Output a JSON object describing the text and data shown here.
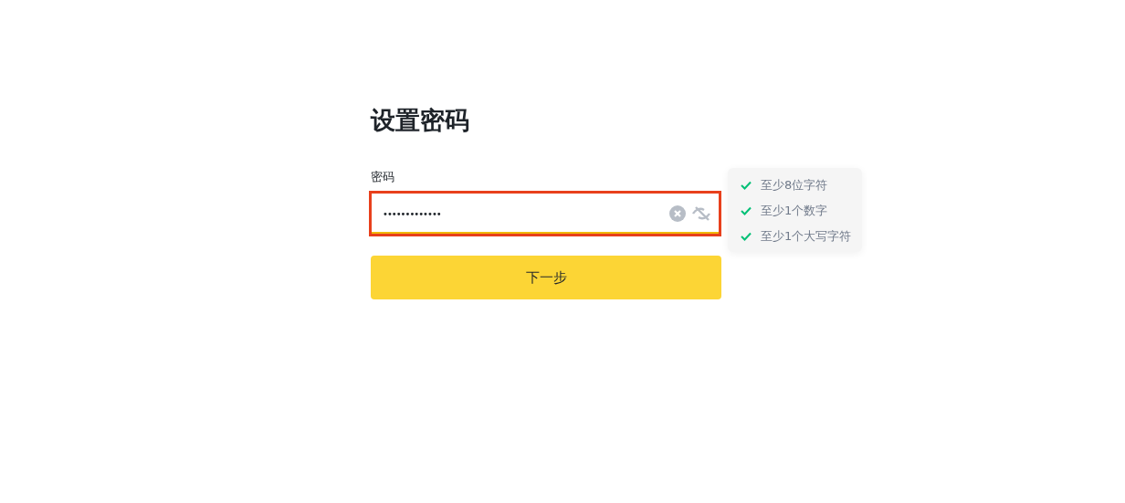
{
  "title": "设置密码",
  "password_field": {
    "label": "密码",
    "value": "•••••••••••••",
    "highlighted": true
  },
  "requirements": [
    {
      "text": "至少8位字符",
      "met": true
    },
    {
      "text": "至少1个数字",
      "met": true
    },
    {
      "text": "至少1个大写字符",
      "met": true
    }
  ],
  "next_button": "下一步"
}
